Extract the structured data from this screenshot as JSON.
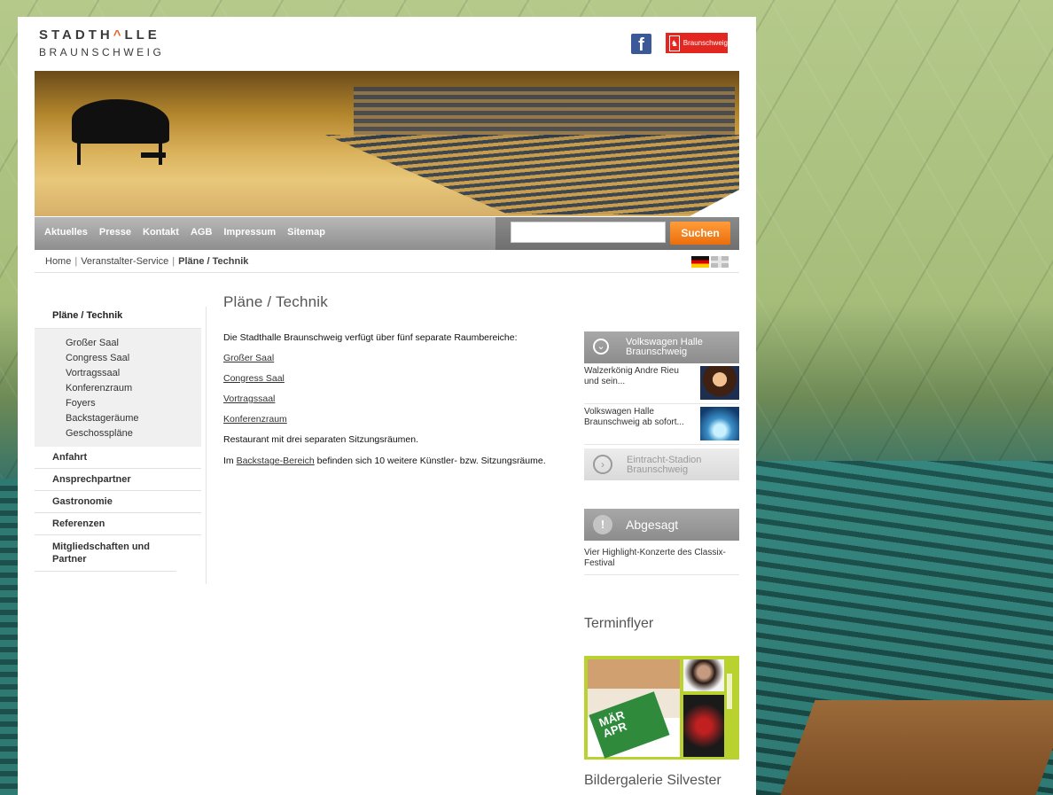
{
  "logo": {
    "line1_a": "STADTH",
    "line1_roof": "^",
    "line1_b": "LLE",
    "line2": "BRAUNSCHWEIG"
  },
  "social": {
    "facebook_glyph": "f",
    "braunschweig_label": "Braunschweig"
  },
  "nav": {
    "links": [
      "Aktuelles",
      "Presse",
      "Kontakt",
      "AGB",
      "Impressum",
      "Sitemap"
    ],
    "search_value": "",
    "search_button": "Suchen"
  },
  "breadcrumb": {
    "home": "Home",
    "service": "Veranstalter-Service",
    "current": "Pläne / Technik",
    "sep": "|"
  },
  "sidebar": {
    "active": "Pläne / Technik",
    "sub_items": [
      "Großer Saal",
      "Congress Saal",
      "Vortragssaal",
      "Konferenzraum",
      "Foyers",
      "Backstageräume",
      "Geschosspläne"
    ],
    "items": [
      "Anfahrt",
      "Ansprechpartner",
      "Gastronomie",
      "Referenzen",
      "Mitgliedschaften und Partner"
    ]
  },
  "main": {
    "title": "Pläne / Technik",
    "intro": "Die Stadthalle Braunschweig verfügt über fünf separate Raumbereiche:",
    "links": [
      "Großer Saal",
      "Congress Saal",
      "Vortragssaal",
      "Konferenzraum"
    ],
    "restaurant": "Restaurant mit drei separaten Sitzungsräumen.",
    "backstage_pre": "Im ",
    "backstage_link": "Backstage-Bereich",
    "backstage_post": " befinden sich 10 weitere Künstler- bzw. Sitzungsräume."
  },
  "right": {
    "vw_title_1": "Volkswagen Halle",
    "vw_title_2": "Braunschweig",
    "vw_icon": "⌄",
    "news": [
      {
        "text": "Walzerkönig Andre Rieu und sein..."
      },
      {
        "text": "Volkswagen Halle Braunschweig ab sofort..."
      }
    ],
    "eintracht_1": "Eintracht-Stadion",
    "eintracht_2": "Braunschweig",
    "eintracht_icon": "›",
    "abgesagt_title": "Abgesagt",
    "abgesagt_icon": "!",
    "abgesagt_text": "Vier Highlight-Konzerte des Classix-Festival",
    "terminflyer": "Terminflyer",
    "flyer_text_1": "MÄR",
    "flyer_text_2": "APR",
    "bildergalerie": "Bildergalerie Silvester"
  }
}
